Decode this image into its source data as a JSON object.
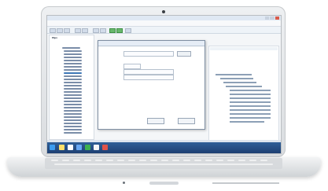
{
  "window": {
    "title": "",
    "menu": []
  },
  "left_panel": {
    "title": "Mpv"
  },
  "dialog": {
    "title": "",
    "fields": [
      {
        "label": "",
        "value": "",
        "button": ""
      },
      {
        "label": "",
        "value": ""
      },
      {
        "label": "",
        "value": ""
      },
      {
        "label": "",
        "value": ""
      }
    ],
    "buttons": [
      "",
      ""
    ]
  },
  "taskbar": {
    "clock": ""
  },
  "colors": {
    "taskbar": "#244d86",
    "accent_green": "#68b86c",
    "accent_red": "#d85a4a"
  },
  "icons": [
    "camera-icon",
    "windows-start-icon",
    "minimize-icon",
    "maximize-icon",
    "close-icon"
  ]
}
